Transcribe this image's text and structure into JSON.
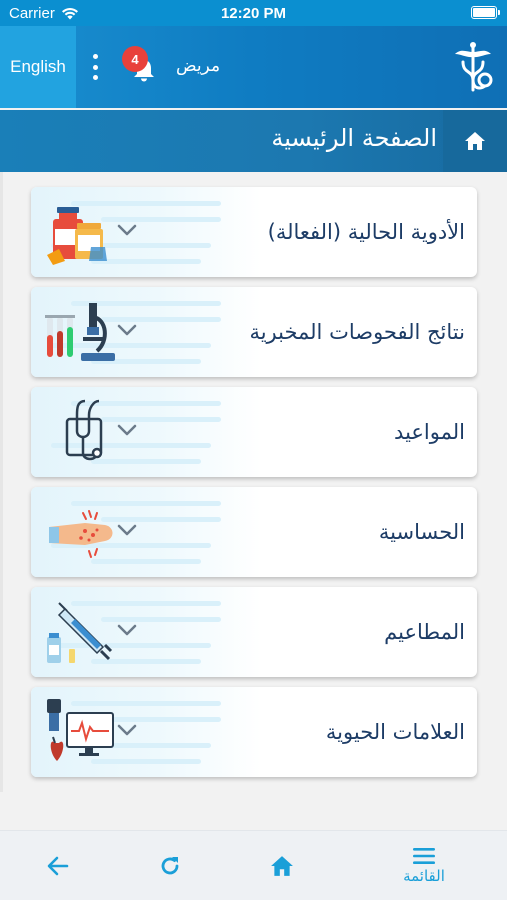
{
  "status_bar": {
    "carrier": "Carrier",
    "time": "12:20 PM"
  },
  "header": {
    "language_button": "English",
    "notification_count": "4",
    "role": "مريض",
    "logo_icon": "caduceus-logo-icon",
    "notification_icon": "bell-icon",
    "more_icon": "kebab-menu-icon"
  },
  "title_bar": {
    "title": "الصفحة الرئيسية",
    "home_icon": "home-icon"
  },
  "cards": [
    {
      "label": "الأدوية الحالية (الفعالة)",
      "icon": "medicine-bottles-icon"
    },
    {
      "label": "نتائج الفحوصات المخبرية",
      "icon": "microscope-test-tubes-icon"
    },
    {
      "label": "المواعيد",
      "icon": "stethoscope-icon"
    },
    {
      "label": "الحساسية",
      "icon": "allergy-hand-icon"
    },
    {
      "label": "المطاعيم",
      "icon": "syringe-vial-icon"
    },
    {
      "label": "العلامات الحيوية",
      "icon": "vital-signs-monitor-icon"
    }
  ],
  "bottom_nav": {
    "back_icon": "arrow-back-icon",
    "refresh_icon": "refresh-icon",
    "home_icon": "home-icon",
    "menu_icon": "hamburger-menu-icon",
    "menu_label": "القائمة"
  },
  "colors": {
    "header_blue": "#0f7cc2",
    "title_bar": "#1c78b0",
    "accent": "#1a9fd8",
    "badge": "#e8413b",
    "text_dark": "#1d3c66"
  }
}
